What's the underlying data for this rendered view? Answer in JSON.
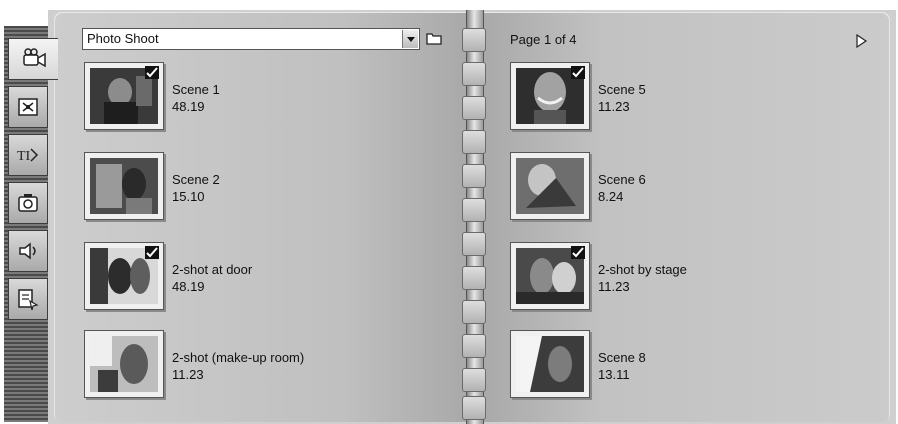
{
  "album": {
    "collection": "Photo Shoot",
    "page_label": "Page 1 of 4"
  },
  "tabs": [
    {
      "id": "video-scenes",
      "icon": "video-camera-icon",
      "active": true
    },
    {
      "id": "transitions",
      "icon": "transitions-icon",
      "active": false
    },
    {
      "id": "effects",
      "icon": "effects-icon",
      "active": false
    },
    {
      "id": "photos",
      "icon": "camera-icon",
      "active": false
    },
    {
      "id": "sound-effects",
      "icon": "speaker-icon",
      "active": false
    },
    {
      "id": "menus",
      "icon": "menu-icon",
      "active": false
    }
  ],
  "scenes_left": [
    {
      "name": "Scene 1",
      "duration": "48.19",
      "checked": true
    },
    {
      "name": "Scene 2",
      "duration": "15.10",
      "checked": false
    },
    {
      "name": "2-shot at door",
      "duration": "48.19",
      "checked": true
    },
    {
      "name": "2-shot (make-up room)",
      "duration": "11.23",
      "checked": false
    }
  ],
  "scenes_right": [
    {
      "name": "Scene 5",
      "duration": "11.23",
      "checked": true
    },
    {
      "name": "Scene 6",
      "duration": "8.24",
      "checked": false
    },
    {
      "name": "2-shot by stage",
      "duration": "11.23",
      "checked": true
    },
    {
      "name": "Scene 8",
      "duration": "13.11",
      "checked": false
    }
  ]
}
